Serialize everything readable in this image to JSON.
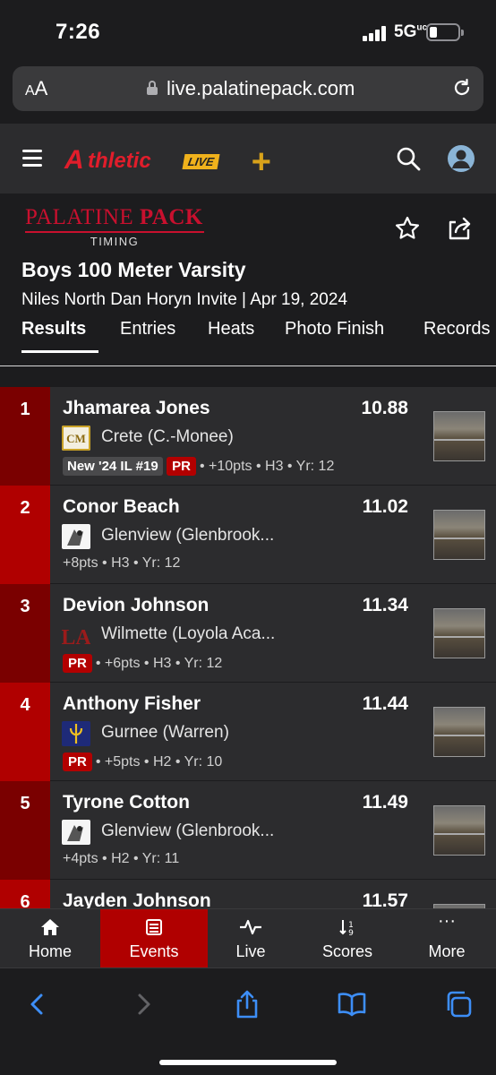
{
  "status_bar": {
    "time": "7:26",
    "network": "5G",
    "network_sup": "uc"
  },
  "browser": {
    "aa_small": "A",
    "aa_large": "A",
    "url": "live.palatinepack.com"
  },
  "site": {
    "logo_a": "A",
    "logo_text": "thletic",
    "logo_live": "LIVE",
    "logo_plus": "+"
  },
  "event": {
    "org_name_1": "PALATINE ",
    "org_name_2": "PACK",
    "org_sub": "TIMING",
    "title": "Boys 100 Meter Varsity",
    "subtitle": "Niles North Dan Horyn Invite | Apr 19, 2024",
    "tabs": [
      {
        "label": "Results",
        "active": true
      },
      {
        "label": "Entries"
      },
      {
        "label": "Heats"
      },
      {
        "label": "Photo Finish"
      },
      {
        "label": "Records"
      }
    ]
  },
  "results": [
    {
      "place": "1",
      "name": "Jhamarea Jones",
      "mark": "10.88",
      "school": "Crete (C.-Monee)",
      "rank_badge": "New '24 IL #19",
      "pr": "PR",
      "meta": "• +10pts • H3 • Yr: 12",
      "logo": "CM",
      "logo_color": "#c9a227"
    },
    {
      "place": "2",
      "name": "Conor Beach",
      "mark": "11.02",
      "school": "Glenview (Glenbrook...",
      "rank_badge": "",
      "pr": "",
      "meta": "+8pts • H3 • Yr: 12",
      "logo": "GB",
      "logo_color": "#ffffff"
    },
    {
      "place": "3",
      "name": "Devion Johnson",
      "mark": "11.34",
      "school": "Wilmette (Loyola Aca...",
      "rank_badge": "",
      "pr": "PR",
      "meta": "• +6pts • H3 • Yr: 12",
      "logo": "LA",
      "logo_color": "#8b1a1a"
    },
    {
      "place": "4",
      "name": "Anthony Fisher",
      "mark": "11.44",
      "school": "Gurnee (Warren)",
      "rank_badge": "",
      "pr": "PR",
      "meta": "• +5pts • H2 • Yr: 10",
      "logo": "W",
      "logo_color": "#1e2a78"
    },
    {
      "place": "5",
      "name": "Tyrone Cotton",
      "mark": "11.49",
      "school": "Glenview (Glenbrook...",
      "rank_badge": "",
      "pr": "",
      "meta": "+4pts • H2 • Yr: 11",
      "logo": "GB",
      "logo_color": "#ffffff"
    },
    {
      "place": "6",
      "name": "Jayden Johnson",
      "mark": "11.57",
      "school": "",
      "rank_badge": "",
      "pr": "",
      "meta": "",
      "logo": "",
      "logo_color": "#ffffff"
    }
  ],
  "bottom_nav": [
    {
      "label": "Home",
      "icon": "home-icon"
    },
    {
      "label": "Events",
      "icon": "events-icon",
      "active": true
    },
    {
      "label": "Live",
      "icon": "live-icon"
    },
    {
      "label": "Scores",
      "icon": "scores-icon"
    },
    {
      "label": "More",
      "icon": "more-icon"
    }
  ],
  "colors": {
    "accent_red": "#b00000",
    "place_bg_odd": "#7a0000",
    "place_bg_even": "#b00000",
    "safari_blue": "#3d8ef7"
  }
}
